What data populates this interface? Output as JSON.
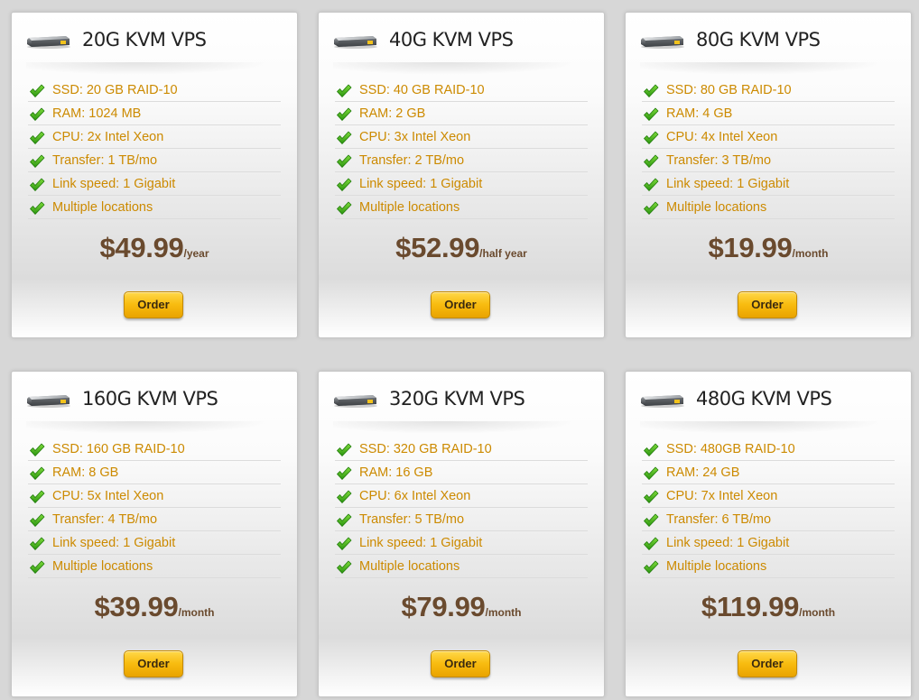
{
  "plans": [
    {
      "title": "20G KVM VPS",
      "features": [
        "SSD: 20 GB RAID-10",
        "RAM: 1024 MB",
        "CPU: 2x Intel Xeon",
        "Transfer: 1 TB/mo",
        "Link speed: 1 Gigabit",
        "Multiple locations"
      ],
      "price": "$49.99",
      "period": "/year",
      "order_label": "Order"
    },
    {
      "title": "40G KVM VPS",
      "features": [
        "SSD: 40 GB RAID-10",
        "RAM: 2 GB",
        "CPU: 3x Intel Xeon",
        "Transfer: 2 TB/mo",
        "Link speed: 1 Gigabit",
        "Multiple locations"
      ],
      "price": "$52.99",
      "period": "/half year",
      "order_label": "Order"
    },
    {
      "title": "80G KVM VPS",
      "features": [
        "SSD: 80 GB RAID-10",
        "RAM: 4 GB",
        "CPU: 4x Intel Xeon",
        "Transfer: 3 TB/mo",
        "Link speed: 1 Gigabit",
        "Multiple locations"
      ],
      "price": "$19.99",
      "period": "/month",
      "order_label": "Order"
    },
    {
      "title": "160G KVM VPS",
      "features": [
        "SSD: 160 GB RAID-10",
        "RAM: 8 GB",
        "CPU: 5x Intel Xeon",
        "Transfer: 4 TB/mo",
        "Link speed: 1 Gigabit",
        "Multiple locations"
      ],
      "price": "$39.99",
      "period": "/month",
      "order_label": "Order"
    },
    {
      "title": "320G KVM VPS",
      "features": [
        "SSD: 320 GB RAID-10",
        "RAM: 16 GB",
        "CPU: 6x Intel Xeon",
        "Transfer: 5 TB/mo",
        "Link speed: 1 Gigabit",
        "Multiple locations"
      ],
      "price": "$79.99",
      "period": "/month",
      "order_label": "Order"
    },
    {
      "title": "480G KVM VPS",
      "features": [
        "SSD: 480GB RAID-10",
        "RAM: 24 GB",
        "CPU: 7x Intel Xeon",
        "Transfer: 6 TB/mo",
        "Link speed: 1 Gigabit",
        "Multiple locations"
      ],
      "price": "$119.99",
      "period": "/month",
      "order_label": "Order"
    }
  ],
  "icons": {
    "header": "server-icon",
    "feature": "check-icon"
  },
  "colors": {
    "feature_text": "#cc8a00",
    "price_text": "#6a4a2e",
    "check_green": "#3aa816",
    "button_yellow": "#f8bc10"
  }
}
